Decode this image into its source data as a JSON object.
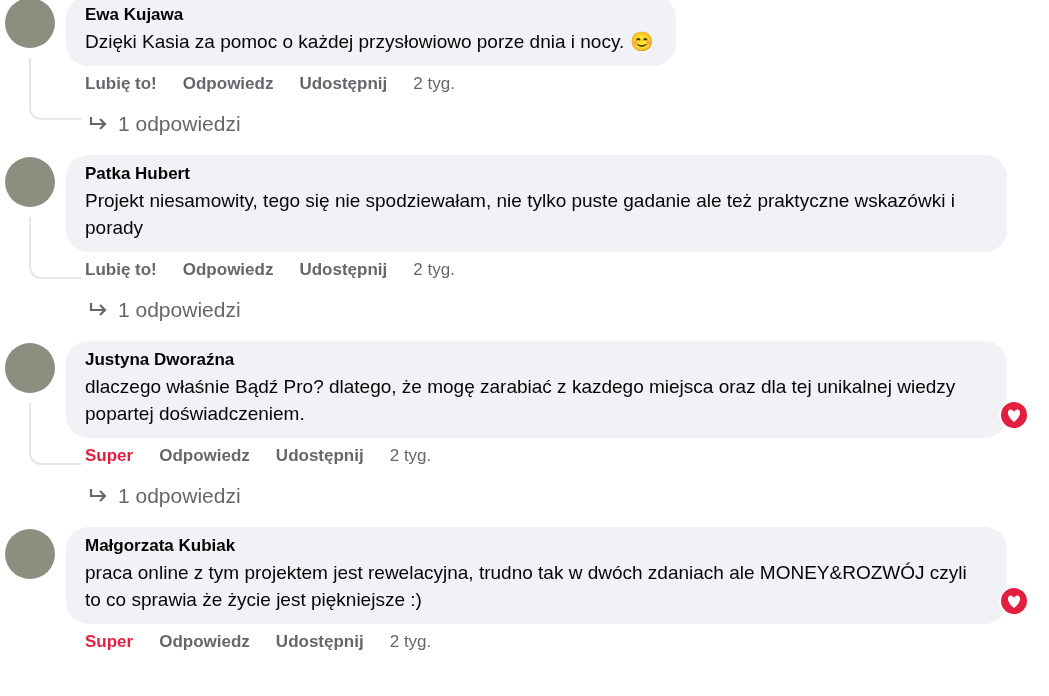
{
  "comments": [
    {
      "author": "Ewa Kujawa",
      "text": "Dzięki Kasia za pomoc o każdej przysłowiowo porze dnia i nocy. 😊",
      "reacted": false,
      "actions": [
        "Lubię to!",
        "Odpowiedz",
        "Udostępnij"
      ],
      "time": "2 tyg.",
      "replies": "1 odpowiedzi"
    },
    {
      "author": "Patka Hubert",
      "text": "Projekt niesamowity, tego się nie spodziewałam, nie tylko puste gadanie ale też praktyczne wskazówki i porady",
      "reacted": false,
      "actions": [
        "Lubię to!",
        "Odpowiedz",
        "Udostępnij"
      ],
      "time": "2 tyg.",
      "replies": "1 odpowiedzi"
    },
    {
      "author": "Justyna Dworaźna",
      "text": "dlaczego właśnie Bądź Pro? dlatego, że mogę zarabiać z kazdego miejsca oraz dla tej unikalnej wiedzy popartej doświadczeniem.",
      "reacted": true,
      "actions": [
        "Super",
        "Odpowiedz",
        "Udostępnij"
      ],
      "time": "2 tyg.",
      "replies": "1 odpowiedzi"
    },
    {
      "author": "Małgorzata Kubiak",
      "text": "praca online z tym projektem jest rewelacyjna, trudno tak w dwóch zdaniach ale MONEY&ROZWÓJ czyli to co sprawia że życie jest piękniejsze :)",
      "reacted": true,
      "actions": [
        "Super",
        "Odpowiedz",
        "Udostępnij"
      ],
      "time": "2 tyg."
    }
  ]
}
